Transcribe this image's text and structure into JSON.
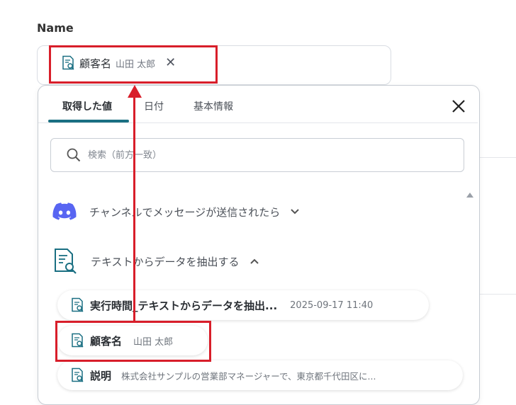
{
  "field": {
    "label": "Name",
    "selected_chip": {
      "title": "顧客名",
      "value": "山田 太郎",
      "icon": "document-search-icon"
    }
  },
  "panel": {
    "tabs": [
      {
        "label": "取得した値",
        "active": true
      },
      {
        "label": "日付",
        "active": false
      },
      {
        "label": "基本情報",
        "active": false
      }
    ],
    "search_placeholder": "検索（前方一致）",
    "groups": [
      {
        "title": "チャンネルでメッセージが送信されたら",
        "icon": "discord-icon",
        "expanded": false
      },
      {
        "title": "テキストからデータを抽出する",
        "icon": "document-search-icon",
        "expanded": true
      }
    ],
    "items": [
      {
        "title": "実行時間_テキストからデータを抽出...",
        "value": "2025-09-17 11:40"
      },
      {
        "title": "顧客名",
        "value": "山田 太郎"
      },
      {
        "title": "説明",
        "value": "株式会社サンプルの営業部マネージャーで、東京都千代田区に..."
      }
    ]
  },
  "colors": {
    "accent": "#1a6f82",
    "annotation_red": "#d81e2a",
    "discord": "#5865f2"
  }
}
